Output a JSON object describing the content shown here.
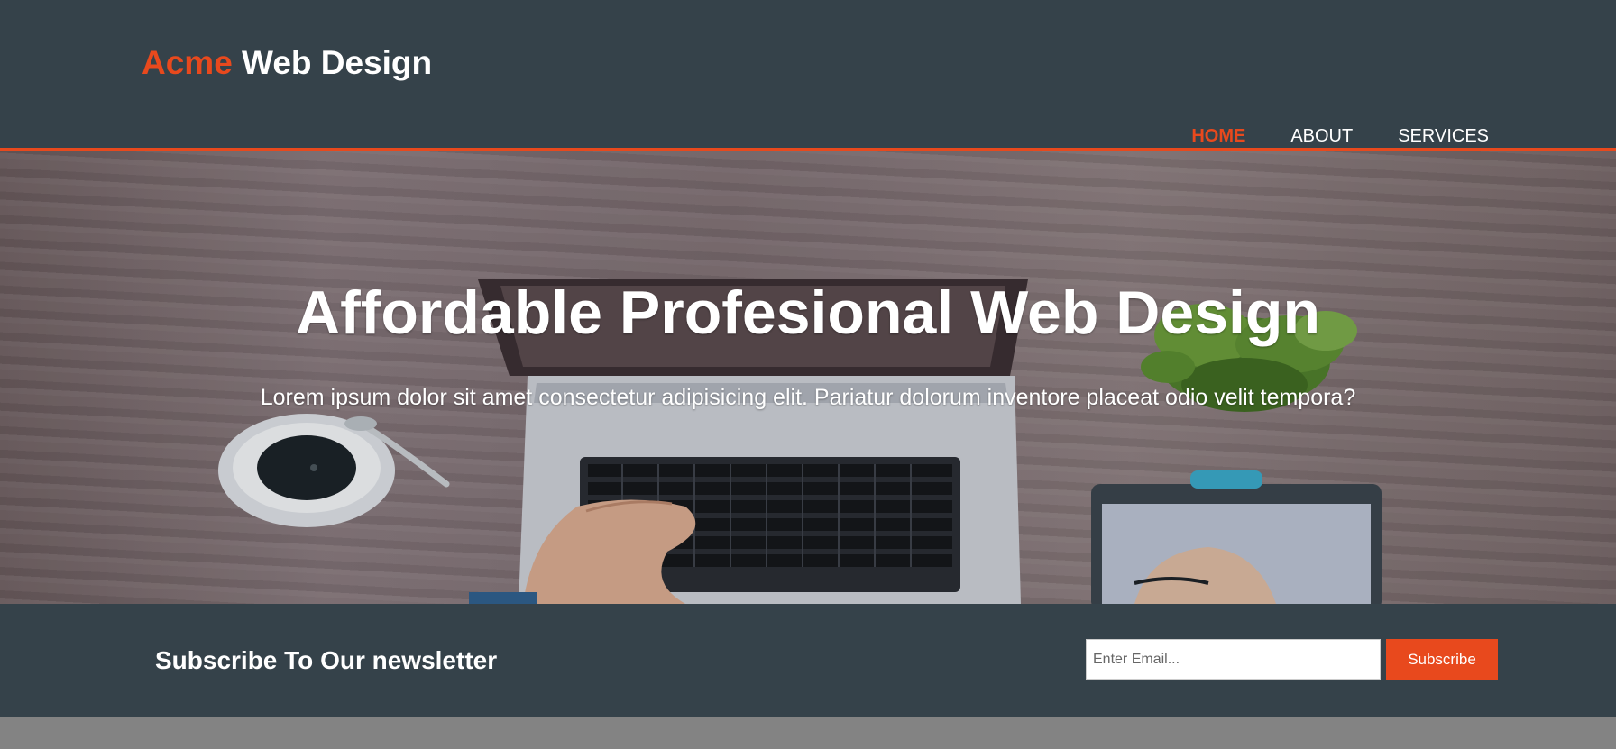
{
  "header": {
    "logo_highlight": "Acme",
    "logo_rest": " Web Design",
    "nav": [
      {
        "label": "HOME",
        "active": true
      },
      {
        "label": "ABOUT",
        "active": false
      },
      {
        "label": "SERVICES",
        "active": false
      }
    ]
  },
  "showcase": {
    "title": "Affordable Profesional Web Design",
    "text": "Lorem ipsum dolor sit amet consectetur adipisicing elit. Pariatur dolorum inventore placeat odio velit tempora?"
  },
  "newsletter": {
    "title": "Subscribe To Our newsletter",
    "email_placeholder": "Enter Email...",
    "email_value": "",
    "button_label": "Subscribe"
  },
  "colors": {
    "dark": "#35424a",
    "accent": "#e8491d",
    "text": "#ffffff"
  }
}
